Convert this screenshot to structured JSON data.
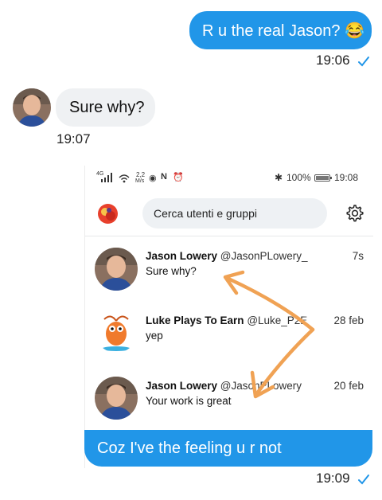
{
  "messages": [
    {
      "text": "R u the real Jason? 😂",
      "time": "19:06"
    },
    {
      "text": "Sure why?",
      "time": "19:07"
    },
    {
      "text": "Coz I've the feeling u r not",
      "time": "19:09"
    }
  ],
  "screenshot": {
    "status_bar": {
      "signal": "4G",
      "speed": "2,2",
      "speed_unit": "M/s",
      "battery": "100%",
      "time": "19:08"
    },
    "search": {
      "placeholder": "Cerca utenti e gruppi"
    },
    "conversations": [
      {
        "name": "Jason Lowery",
        "handle": "@JasonPLowery_",
        "preview": "Sure why?",
        "time": "7s"
      },
      {
        "name": "Luke Plays To Earn",
        "handle": "@Luke_P2E",
        "preview": "yep",
        "time": "28 feb"
      },
      {
        "name": "Jason Lowery",
        "handle": "@JasonPLowery",
        "preview": "Your work is great",
        "time": "20 feb"
      }
    ]
  },
  "colors": {
    "outgoing_bubble": "#2196e8",
    "incoming_bubble": "#eff1f3",
    "read_check": "#2196e8",
    "annotation_arrow": "#f0a254"
  },
  "icons": [
    "read-check-icon",
    "gear-icon",
    "signal-icon",
    "wifi-icon",
    "nfc-icon",
    "alarm-icon",
    "bluetooth-icon",
    "battery-icon"
  ]
}
